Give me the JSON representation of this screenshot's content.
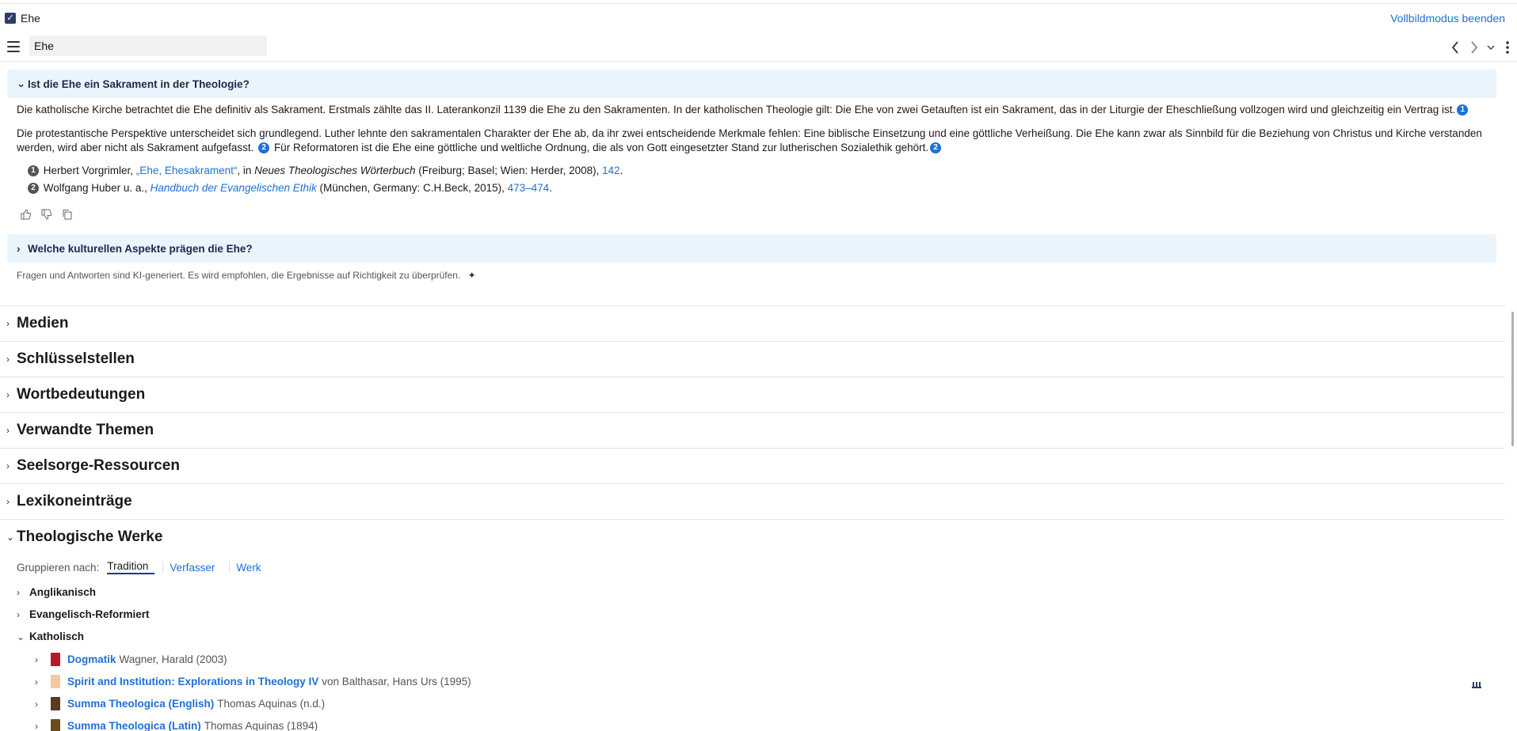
{
  "topbar": {
    "title": "Ehe",
    "exit_fullscreen": "Vollbildmodus beenden"
  },
  "search": {
    "value": "Ehe"
  },
  "qa1": {
    "question": "Ist die Ehe ein Sakrament in der Theologie?",
    "para1": "Die katholische Kirche betrachtet die Ehe definitiv als Sakrament. Erstmals zählte das II. Laterankonzil 1139 die Ehe zu den Sakramenten. In der katholischen Theologie gilt: Die Ehe von zwei Getauften ist ein Sakrament, das in der Liturgie der Eheschließung vollzogen wird und gleichzeitig ein Vertrag ist.",
    "para2a": "Die protestantische Perspektive unterscheidet sich grundlegend. Luther lehnte den sakramentalen Charakter der Ehe ab, da ihr zwei entscheidende Merkmale fehlen: Eine biblische Einsetzung und eine göttliche Verheißung. Die Ehe kann zwar als Sinnbild für die Beziehung von Christus und Kirche verstanden werden, wird aber nicht als Sakrament aufgefasst.",
    "para2b": "Für Reformatoren ist die Ehe eine göttliche und weltliche Ordnung, die als von Gott eingesetzter Stand zur lutherischen Sozialethik gehört.",
    "ref1": "1",
    "ref2": "2",
    "footnotes": [
      {
        "num": "1",
        "author": "Herbert Vorgrimler, ",
        "title": "„Ehe, Ehesakrament“",
        "mid": ", in ",
        "book": "Neues Theologisches Wörterbuch",
        "pub": " (Freiburg; Basel; Wien: Herder, 2008), ",
        "page": "142",
        "end": "."
      },
      {
        "num": "2",
        "author": "Wolfgang Huber u. a., ",
        "book": "Handbuch der Evangelischen Ethik",
        "pub": " (München, Germany: C.H.Beck, 2015), ",
        "page": "473–474",
        "end": "."
      }
    ]
  },
  "qa2": {
    "question": "Welche kulturellen Aspekte prägen die Ehe?"
  },
  "disclaimer": "Fragen und Antworten sind KI-generiert. Es wird empfohlen, die Ergebnisse auf Richtigkeit zu überprüfen.",
  "sections": [
    "Medien",
    "Schlüsselstellen",
    "Wortbedeutungen",
    "Verwandte Themen",
    "Seelsorge-Ressourcen",
    "Lexikoneinträge",
    "Theologische Werke"
  ],
  "group_by": {
    "label": "Gruppieren nach:",
    "tabs": [
      "Tradition",
      "Verfasser",
      "Werk"
    ]
  },
  "traditions": [
    "Anglikanisch",
    "Evangelisch-Reformiert",
    "Katholisch"
  ],
  "works": [
    {
      "title": "Dogmatik",
      "meta": "Wagner, Harald (2003)",
      "cover": "#b5192b"
    },
    {
      "title": "Spirit and Institution: Explorations in Theology IV",
      "meta": "von Balthasar, Hans Urs (1995)",
      "cover": "#f0c9a0"
    },
    {
      "title": "Summa Theologica (English)",
      "meta": "Thomas Aquinas (n.d.)",
      "cover": "#5a3a22"
    },
    {
      "title": "Summa Theologica (Latin)",
      "meta": "Thomas Aquinas (1894)",
      "cover": "#6b4a1e"
    }
  ]
}
